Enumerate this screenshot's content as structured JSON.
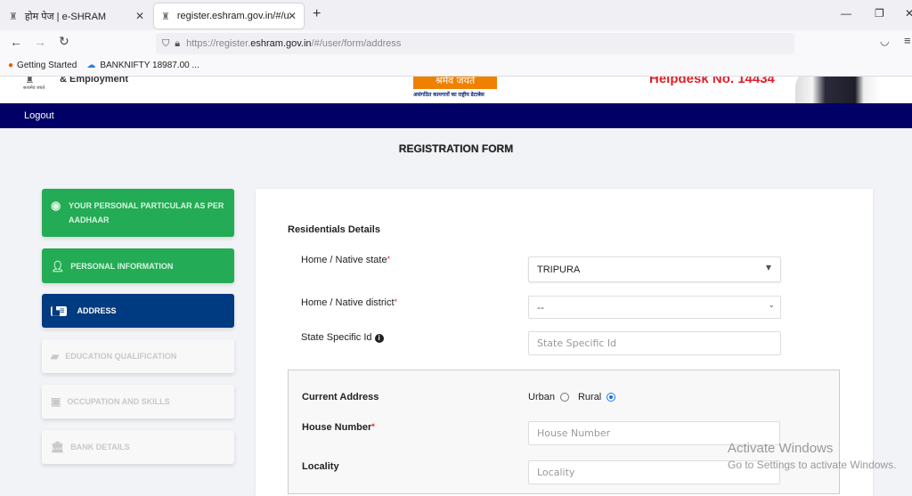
{
  "browser": {
    "tabs": [
      {
        "label": "होम पेज | e-SHRAM",
        "favicon": "emblem-icon"
      },
      {
        "label": "register.eshram.gov.in/#/user/s",
        "favicon": "emblem-icon"
      }
    ],
    "url_prefix": "https://register.",
    "url_domain": "eshram.gov.in",
    "url_path": "/#/user/form/address",
    "bookmarks": [
      {
        "label": "Getting Started"
      },
      {
        "label": "BANKNIFTY 18987.00 ..."
      }
    ]
  },
  "header": {
    "ministry": "& Employment",
    "emblem_motto": "सत्यमेव जयते",
    "slogan": "श्रमेव जयते",
    "tagline": "असंगठित कामगारों का राष्ट्रीय डेटाबेस",
    "helpdesk": "Helpdesk No. 14434"
  },
  "nav": {
    "logout": "Logout"
  },
  "page_title": "REGISTRATION FORM",
  "sidebar": [
    {
      "label": "YOUR PERSONAL PARTICULAR AS PER AADHAAR",
      "state": "completed",
      "icon": "user-circle-icon"
    },
    {
      "label": "PERSONAL INFORMATION",
      "state": "completed",
      "icon": "user-icon"
    },
    {
      "label": "ADDRESS",
      "state": "active",
      "icon": "id-card-icon"
    },
    {
      "label": "EDUCATION QUALIFICATION",
      "state": "disabled",
      "icon": "book-icon"
    },
    {
      "label": "OCCUPATION AND SKILLS",
      "state": "disabled",
      "icon": "briefcase-icon"
    },
    {
      "label": "BANK DETAILS",
      "state": "disabled",
      "icon": "bank-icon"
    }
  ],
  "form": {
    "section": "Residentials Details",
    "state_label": "Home / Native state",
    "state_value": "TRIPURA",
    "district_label": "Home / Native district",
    "district_value": "--",
    "ssid_label": "State Specific Id",
    "ssid_placeholder": "State Specific Id",
    "current_address": "Current Address",
    "urban": "Urban",
    "rural": "Rural",
    "selected_area": "Rural",
    "house_label": "House Number",
    "house_placeholder": "House Number",
    "locality_label": "Locality",
    "locality_placeholder": "Locality",
    "required_mark": "*"
  },
  "watermark": {
    "title": "Activate Windows",
    "subtitle": "Go to Settings to activate Windows."
  },
  "colors": {
    "green": "#24ab55",
    "active": "#003a80",
    "navband": "#000066",
    "helpdesk": "#e0202a",
    "orange": "#f08000"
  }
}
